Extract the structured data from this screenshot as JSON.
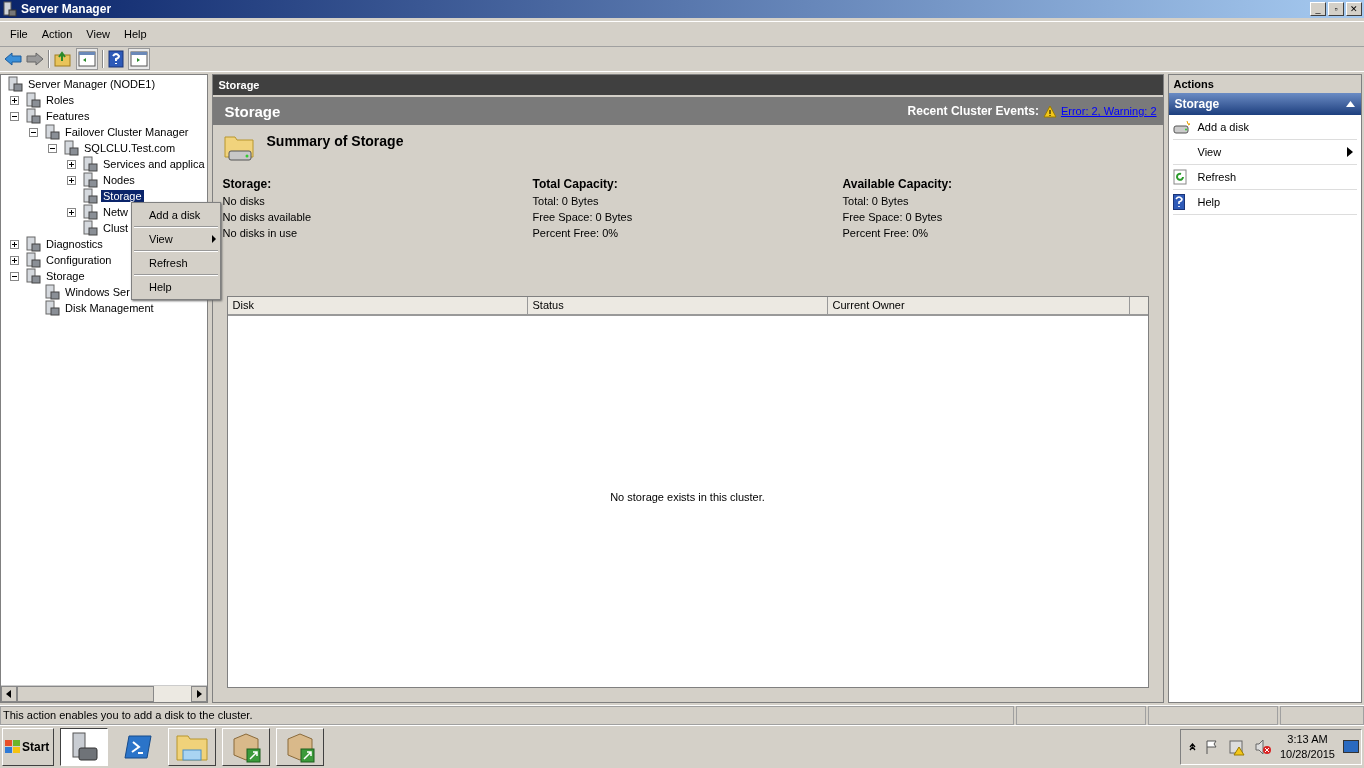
{
  "window": {
    "title": "Server Manager",
    "controls": [
      "_",
      "▫",
      "✕"
    ]
  },
  "menu": [
    "File",
    "Action",
    "View",
    "Help"
  ],
  "tree": [
    {
      "label": "Server Manager (NODE1)",
      "kind": "root",
      "selected": false,
      "children": [
        {
          "label": "Roles",
          "kind": "branch",
          "expanded": false,
          "selected": false
        },
        {
          "label": "Features",
          "kind": "branch",
          "expanded": true,
          "selected": false,
          "children": [
            {
              "label": "Failover Cluster Manager",
              "kind": "branch",
              "expanded": true,
              "selected": false,
              "children": [
                {
                  "label": "SQLCLU.Test.com",
                  "kind": "branch",
                  "expanded": true,
                  "selected": false,
                  "children": [
                    {
                      "label": "Services and applica",
                      "kind": "branch",
                      "expanded": false,
                      "selected": false
                    },
                    {
                      "label": "Nodes",
                      "kind": "branch",
                      "expanded": false,
                      "selected": false
                    },
                    {
                      "label": "Storage",
                      "kind": "leaf",
                      "selected": true
                    },
                    {
                      "label": "Netw",
                      "kind": "branch",
                      "expanded": false,
                      "selected": false
                    },
                    {
                      "label": "Clust",
                      "kind": "leaf",
                      "selected": false
                    }
                  ]
                }
              ]
            }
          ]
        },
        {
          "label": "Diagnostics",
          "kind": "branch",
          "expanded": false,
          "selected": false
        },
        {
          "label": "Configuration",
          "kind": "branch",
          "expanded": false,
          "selected": false
        },
        {
          "label": "Storage",
          "kind": "branch",
          "expanded": true,
          "selected": false,
          "children": [
            {
              "label": "Windows Ser",
              "kind": "leaf",
              "selected": false
            },
            {
              "label": "Disk Management",
              "kind": "leaf",
              "selected": false
            }
          ]
        }
      ]
    }
  ],
  "context_menu": [
    {
      "label": "Add a disk",
      "submenu": false
    },
    {
      "label": "View",
      "submenu": true
    },
    {
      "label": "Refresh",
      "submenu": false
    },
    {
      "label": "Help",
      "submenu": false
    }
  ],
  "content": {
    "header": "Storage",
    "band_title": "Storage",
    "events_label": "Recent Cluster Events:",
    "events_link": "Error: 2, Warning: 2",
    "summary_title": "Summary of Storage",
    "summary_columns": [
      {
        "heading": "Storage:",
        "lines": [
          "No disks",
          "No disks available",
          "No disks in use"
        ]
      },
      {
        "heading": "Total Capacity:",
        "lines": [
          "Total: 0 Bytes",
          "Free Space: 0 Bytes",
          "Percent Free: 0%"
        ]
      },
      {
        "heading": "Available Capacity:",
        "lines": [
          "Total: 0 Bytes",
          "Free Space: 0 Bytes",
          "Percent Free: 0%"
        ]
      }
    ],
    "table": {
      "columns": [
        "Disk",
        "Status",
        "Current Owner"
      ],
      "empty_message": "No storage exists in this cluster."
    }
  },
  "actions": {
    "title": "Actions",
    "section": "Storage",
    "items": [
      {
        "label": "Add a disk",
        "kind": "disk",
        "submenu": false
      },
      {
        "label": "View",
        "kind": "plain",
        "submenu": true
      },
      {
        "label": "Refresh",
        "kind": "refresh",
        "submenu": false
      },
      {
        "label": "Help",
        "kind": "help",
        "submenu": false
      }
    ]
  },
  "status_bar": "This action enables you to add a disk to the cluster.",
  "taskbar": {
    "start": "Start",
    "buttons": [
      {
        "kind": "server",
        "selected": true
      },
      {
        "kind": "shell",
        "selected": false
      },
      {
        "kind": "folder",
        "selected": false
      },
      {
        "kind": "package",
        "selected": false
      },
      {
        "kind": "package",
        "selected": false
      }
    ],
    "time": "3:13 AM",
    "date": "10/28/2015"
  }
}
